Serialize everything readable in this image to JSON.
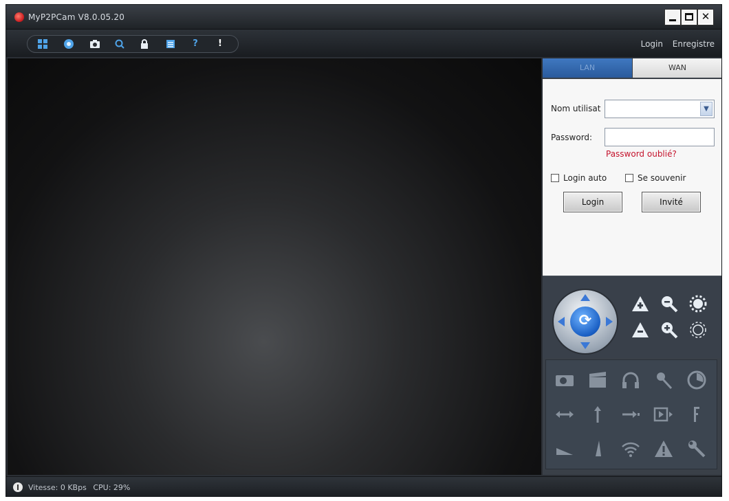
{
  "window": {
    "title": "MyP2PCam  V8.0.05.20",
    "controls": [
      "minimize",
      "maximize",
      "close"
    ]
  },
  "toolbar": {
    "icons": [
      "grid-view-icon",
      "record-icon",
      "snapshot-icon",
      "search-icon",
      "lock-icon",
      "settings-list-icon",
      "help-icon",
      "info-icon"
    ],
    "login_link": "Login",
    "register_link": "Enregistre"
  },
  "side_panel": {
    "tabs": [
      {
        "label": "LAN",
        "active": true
      },
      {
        "label": "WAN",
        "active": false
      }
    ],
    "login_form": {
      "username_label": "Nom utilisat",
      "username_value": "",
      "password_label": "Password:",
      "password_value": "",
      "forgot_password": "Password oublié?",
      "auto_login_label": "Login auto",
      "auto_login_checked": false,
      "remember_label": "Se souvenir",
      "remember_checked": false,
      "login_button": "Login",
      "guest_button": "Invité"
    },
    "ptz": {
      "joystick_center_icon": "refresh-icon",
      "buttons": [
        "focus-up-icon",
        "zoom-out-icon",
        "brightness-up-icon",
        "focus-down-icon",
        "zoom-in-icon",
        "brightness-down-icon"
      ]
    },
    "function_grid": [
      [
        "camera-icon",
        "clapper-icon",
        "headphones-icon",
        "microphone-icon",
        "clock-icon"
      ],
      [
        "horizontal-flip-icon",
        "vertical-flip-icon",
        "arrow-right-icon",
        "input-icon",
        "preset-icon"
      ],
      [
        "speed-low-icon",
        "speed-high-icon",
        "wifi-icon",
        "alarm-icon",
        "wrench-icon"
      ]
    ]
  },
  "status_bar": {
    "speed": "Vitesse: 0 KBps",
    "cpu": "CPU:  29%"
  },
  "colors": {
    "accent_blue": "#3b78d6",
    "link_red": "#c4132c",
    "window_dark": "#2b2f35"
  }
}
